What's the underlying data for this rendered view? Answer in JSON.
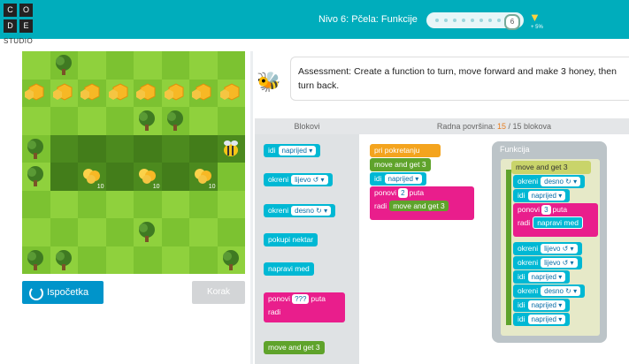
{
  "header": {
    "logo_letters": [
      "C",
      "O",
      "D",
      "E"
    ],
    "logo_studio": "STUDIO",
    "level_title": "Nivo 6: Pčela: Funkcije",
    "progress_current": "6",
    "trophy_sub": "+ 5%"
  },
  "instructions": {
    "text": "Assessment: Create a function to turn, move forward and make 3 honey, then turn back."
  },
  "controls": {
    "reset_label": "Ispočetka",
    "step_label": "Korak"
  },
  "workspace_header": {
    "toolbox_label": "Blokovi",
    "workspace_label": "Radna površina:",
    "block_count": "15",
    "block_limit": "/ 15 blokova"
  },
  "toolbox": {
    "move": {
      "label": "idi",
      "option": "naprijed ▾"
    },
    "turn_left": {
      "label": "okreni",
      "option": "lijevo ↺ ▾"
    },
    "turn_right": {
      "label": "okreni",
      "option": "desno ↻ ▾"
    },
    "get_nectar": {
      "label": "pokupi nektar"
    },
    "make_honey": {
      "label": "napravi med"
    },
    "repeat": {
      "label": "ponovi",
      "count": "???",
      "suffix": "puta",
      "do": "radi"
    },
    "function_call": {
      "label": "move and get 3"
    }
  },
  "program": {
    "when_run": "pri pokretanju",
    "call1": "move and get 3",
    "move": {
      "label": "idi",
      "option": "naprijed ▾"
    },
    "repeat": {
      "label": "ponovi",
      "count": "2",
      "suffix": "puta",
      "do": "radi",
      "inner": "move and get 3"
    }
  },
  "function_def": {
    "title": "Funkcija",
    "name": "move and get 3",
    "b1": {
      "label": "okreni",
      "option": "desno ↻ ▾"
    },
    "b2": {
      "label": "idi",
      "option": "naprijed ▾"
    },
    "repeat": {
      "label": "ponovi",
      "count": "3",
      "suffix": "puta",
      "do": "radi",
      "inner": "napravi med"
    },
    "b3": {
      "label": "okreni",
      "option": "lijevo ↺ ▾"
    },
    "b4": {
      "label": "okreni",
      "option": "lijevo ↺ ▾"
    },
    "b5": {
      "label": "idi",
      "option": "naprijed ▾"
    },
    "b6": {
      "label": "okreni",
      "option": "desno ↻ ▾"
    },
    "b7": {
      "label": "idi",
      "option": "naprijed ▾"
    },
    "b8": {
      "label": "idi",
      "option": "naprijed ▾"
    }
  },
  "maze": {
    "rows": [
      "gtgggggg",
      "hhhhhhhh",
      "ggggttgg",
      "tppppppb",
      "tpfpfpfg",
      "gggggggg",
      "ggggtggg",
      "ttgggggt"
    ],
    "flower_values": [
      "10",
      "10",
      "10"
    ]
  },
  "colors": {
    "accent": "#00adbc",
    "button": "#0094ca",
    "block_cyan": "#00b8d4",
    "block_green": "#5fa32b",
    "block_magenta": "#e91e8c",
    "block_orange": "#f4a41e"
  }
}
